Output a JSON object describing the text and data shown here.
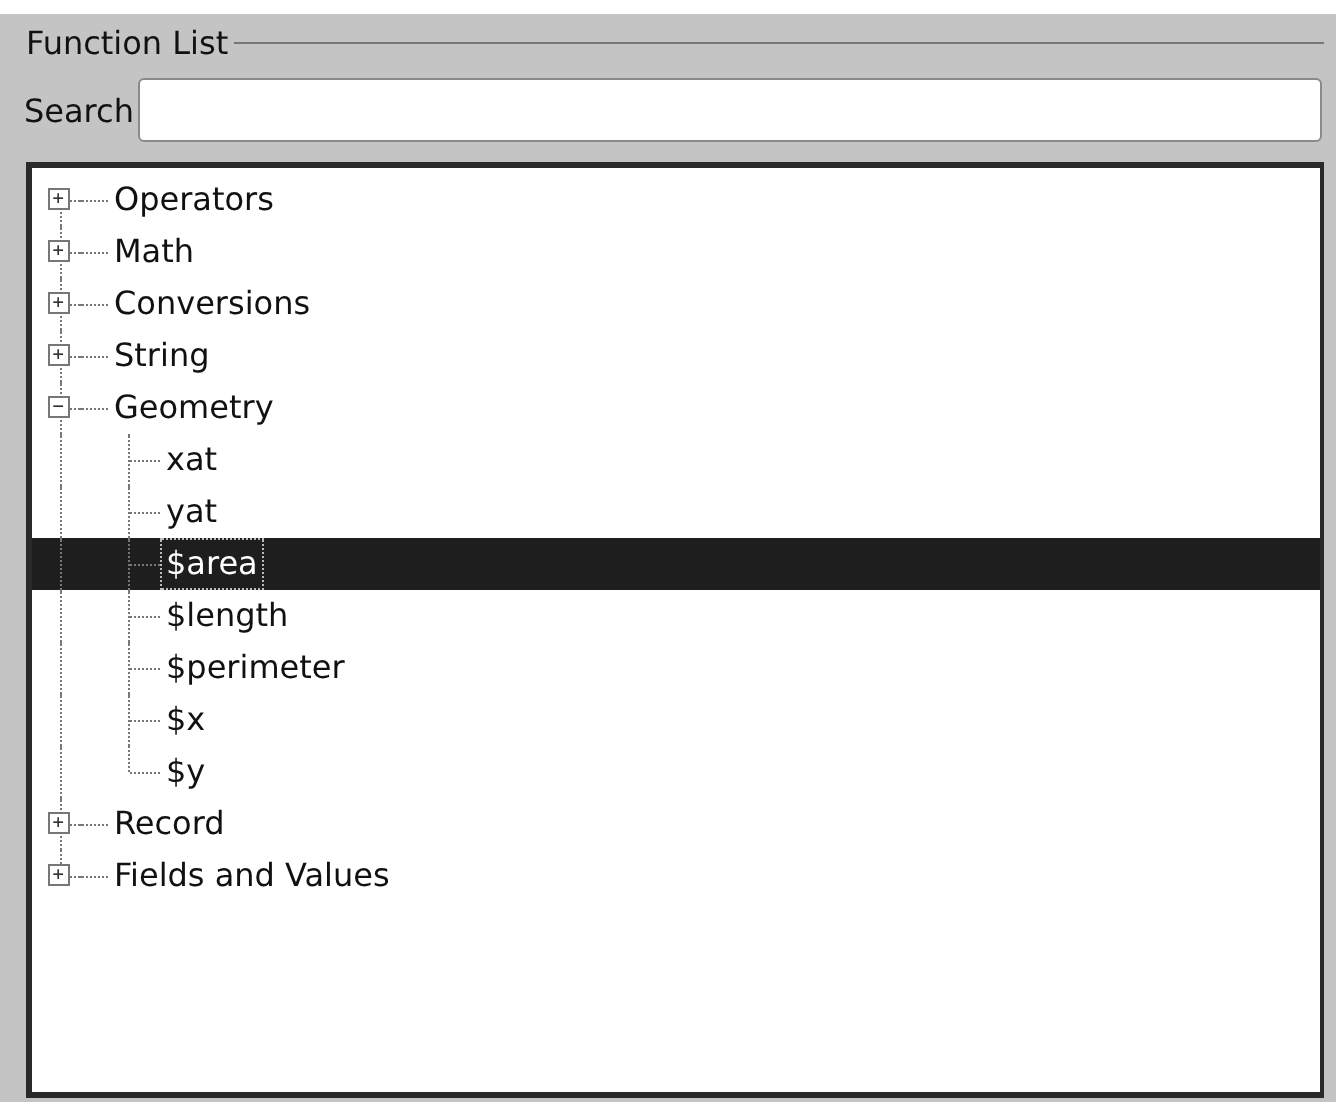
{
  "panel": {
    "title": "Function List"
  },
  "search": {
    "label": "Search"
  },
  "tree": [
    {
      "label": "Operators",
      "expanded": false,
      "selected": false
    },
    {
      "label": "Math",
      "expanded": false,
      "selected": false
    },
    {
      "label": "Conversions",
      "expanded": false,
      "selected": false
    },
    {
      "label": "String",
      "expanded": false,
      "selected": false
    },
    {
      "label": "Geometry",
      "expanded": true,
      "selected": false,
      "children": [
        {
          "label": "xat",
          "selected": false
        },
        {
          "label": "yat",
          "selected": false
        },
        {
          "label": "$area",
          "selected": true
        },
        {
          "label": "$length",
          "selected": false
        },
        {
          "label": "$perimeter",
          "selected": false
        },
        {
          "label": "$x",
          "selected": false
        },
        {
          "label": "$y",
          "selected": false
        }
      ]
    },
    {
      "label": "Record",
      "expanded": false,
      "selected": false
    },
    {
      "label": "Fields and Values",
      "expanded": false,
      "selected": false
    }
  ]
}
